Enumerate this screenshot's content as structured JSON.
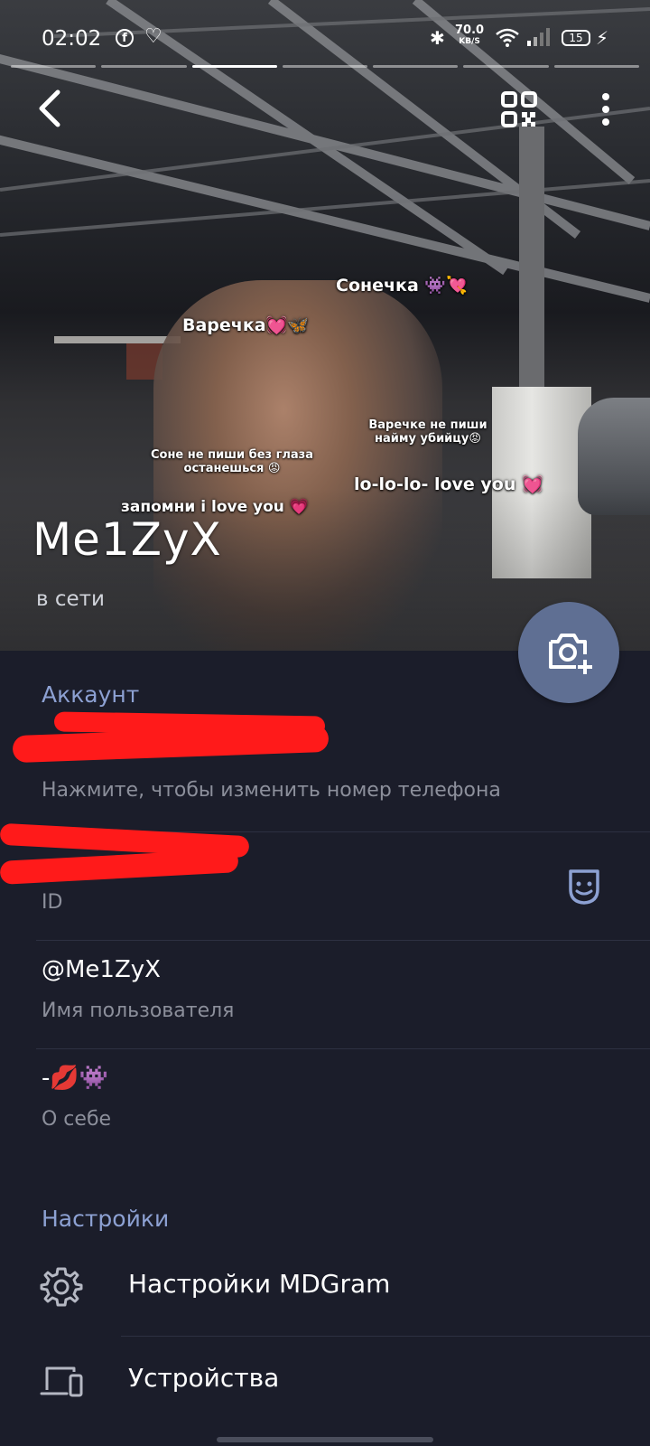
{
  "status_bar": {
    "time": "02:02",
    "network_speed": "70.0",
    "network_unit": "KB/S",
    "battery": "15"
  },
  "story": {
    "segments": 7,
    "active_segment": 3
  },
  "photo_stickers": {
    "sonechka": "Сонечка 👾💘",
    "varechka": "Варечка💓🦋",
    "varechke_ne_pishi": "Варечке не пиши найму убийцу😡",
    "sone_ne_pishi": "Соне не пиши без глаза останешься 😡",
    "lololo": "lo-lo-lo- love you 💓",
    "zapomni": "запомни i love you 💗"
  },
  "profile": {
    "name": "Me1ZyX",
    "status": "в сети"
  },
  "account": {
    "title": "Аккаунт",
    "phone_hint": "Нажмите, чтобы изменить номер телефона",
    "id_label": "ID",
    "username": "@Me1ZyX",
    "username_label": "Имя пользователя",
    "bio": "-💋👾",
    "bio_label": "О себе"
  },
  "settings": {
    "title": "Настройки",
    "items": [
      {
        "label": "Настройки MDGram",
        "icon": "gear-icon"
      },
      {
        "label": "Устройства",
        "icon": "devices-icon"
      }
    ]
  },
  "colors": {
    "background": "#1b1d2a",
    "accent": "#8da1d3",
    "fab": "#5f6f93",
    "secondary_text": "#8c8f9b",
    "redaction": "#ff1a1a"
  }
}
